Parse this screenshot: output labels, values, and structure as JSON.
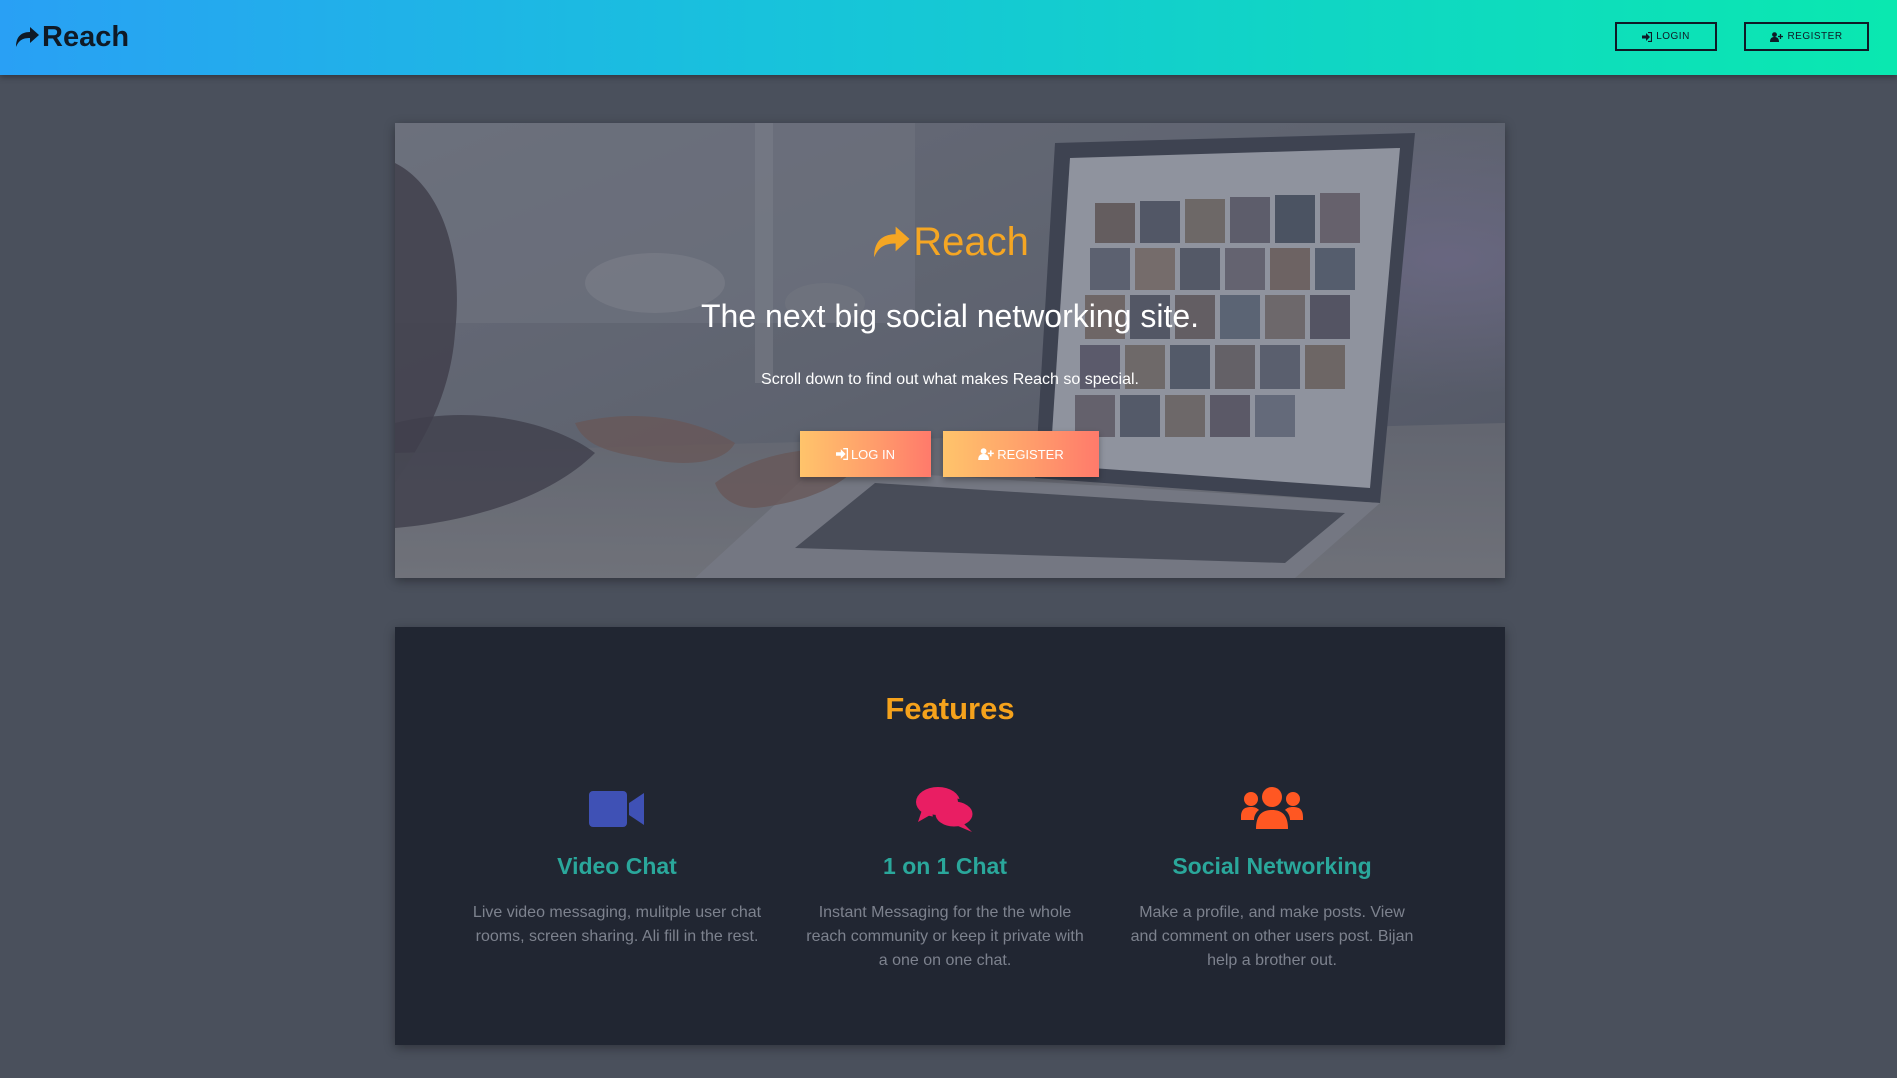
{
  "navbar": {
    "brand": "Reach",
    "login_label": "LOGIN",
    "register_label": "REGISTER"
  },
  "hero": {
    "brand": "Reach",
    "title": "The next big social networking site.",
    "subtitle": "Scroll down to find out what makes Reach so special.",
    "login_label": "LOG IN",
    "register_label": "REGISTER"
  },
  "features": {
    "title": "Features",
    "items": [
      {
        "icon": "video-camera-icon",
        "color": "#3f51b5",
        "title": "Video Chat",
        "description": "Live video messaging, mulitple user chat rooms, screen sharing. Ali fill in the rest."
      },
      {
        "icon": "chat-bubbles-icon",
        "color": "#e91e63",
        "title": "1 on 1 Chat",
        "description": "Instant Messaging for the the whole reach community or keep it private with a one on one chat."
      },
      {
        "icon": "users-icon",
        "color": "#ff5722",
        "title": "Social Networking",
        "description": "Make a profile, and make posts. View and comment on other users post. Bijan help a brother out."
      }
    ]
  },
  "colors": {
    "navbar_gradient_start": "#29a0f5",
    "navbar_gradient_end": "#0ae8b0",
    "accent_orange": "#f5a21c",
    "feature_title_teal": "#2aa79b",
    "page_background": "#4a505c",
    "features_background": "#212632"
  }
}
